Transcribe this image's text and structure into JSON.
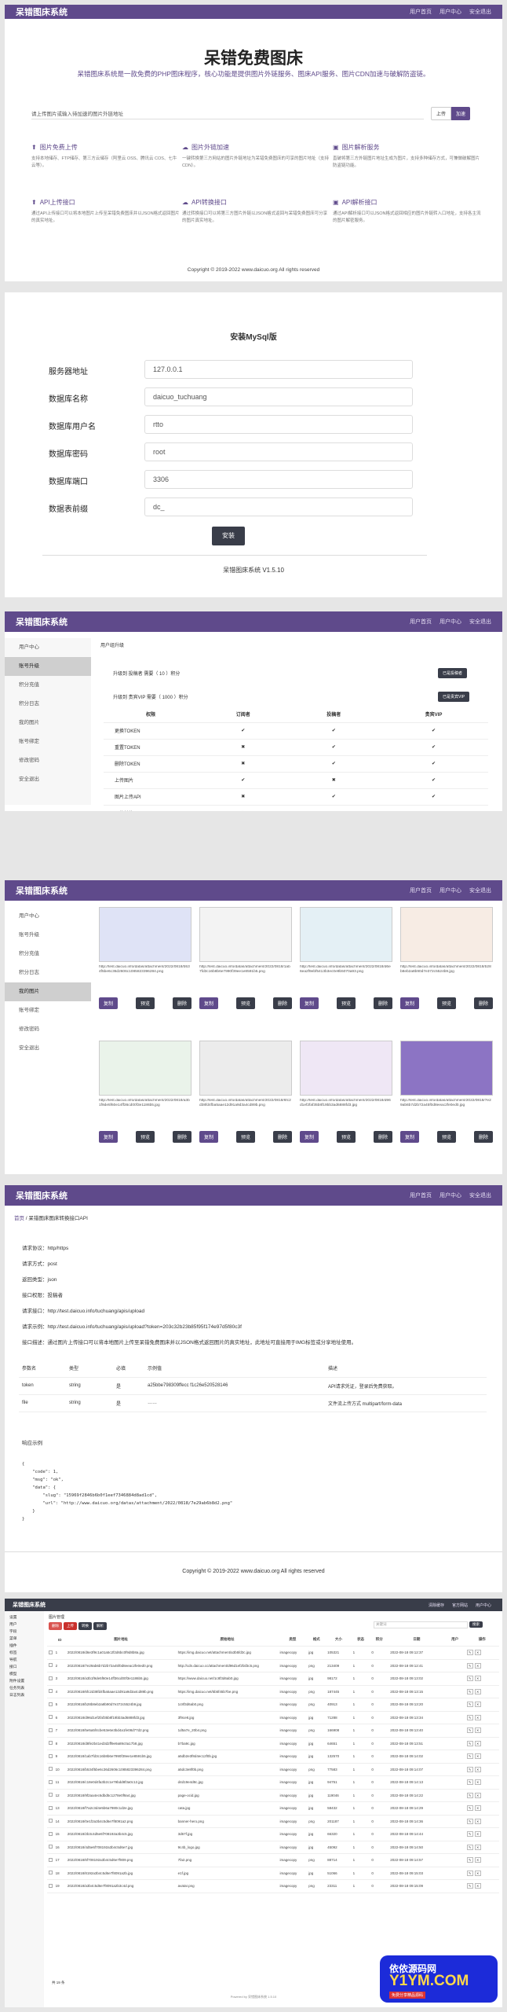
{
  "colors": {
    "purple": "#5f4a8b",
    "dark": "#393d49",
    "light": "#f7f7f7"
  },
  "s1": {
    "brand": "呆错图床系统",
    "nav": [
      "用户首页",
      "用户中心",
      "安全退出"
    ],
    "hero_title": "呆错免费图床",
    "hero_desc": "呆错图床系统是一款免费的PHP图床程序，核心功能是提供图片外链服务、图床API服务、图片CDN加速与破解防盗链。",
    "upload_tip": "请上传图片或输入待加速的图片外链地址",
    "btn_upload": "上传",
    "btn_speed": "加速",
    "features": [
      {
        "title": "图片免费上传",
        "desc": "支持本地储存、FTP储存、第三方云储存（阿里云 OSS、腾讯云 COS、七牛云等）。"
      },
      {
        "title": "图片外链加速",
        "desc": "一键转换第三方网站的图片外链地址为呆错免费图床的可享的图片地址（支持CDN）。"
      },
      {
        "title": "图片解析服务",
        "desc": "直破将第三方外链图片地址生成为图片，支持多种储存方式，可兼做破解图片防盗链功能。"
      },
      {
        "title": "API上传接口",
        "desc": "通过API上传接口可以将本地图片上传至呆错免费图床并以JSON格式返回图片的真实地址。"
      },
      {
        "title": "API转换接口",
        "desc": "通过转换接口可以将第三方图片外链以JSON格式返回与呆错免费图床可分享的图片真实地址。"
      },
      {
        "title": "API解析接口",
        "desc": "通过API解析接口可以JSON格式返回相应的图片外链转入口地址，支持各主流的图片解密服务。"
      }
    ],
    "copyright": "Copyright © 2019-2022 www.daicuo.org All rights reserved"
  },
  "s2": {
    "title": "安装MySql版",
    "fields": [
      {
        "label": "服务器地址",
        "value": "127.0.0.1"
      },
      {
        "label": "数据库名称",
        "value": "daicuo_tuchuang"
      },
      {
        "label": "数据库用户名",
        "value": "rtto"
      },
      {
        "label": "数据库密码",
        "value": "root"
      },
      {
        "label": "数据库端口",
        "value": "3306"
      },
      {
        "label": "数据表前缀",
        "value": "dc_"
      }
    ],
    "btn": "安装",
    "version": "呆错图床系统 V1.5.10"
  },
  "s3": {
    "brand": "呆错图床系统",
    "nav": [
      "用户首页",
      "用户中心",
      "安全退出"
    ],
    "menu": [
      "用户中心",
      "账号升级",
      "积分充值",
      "积分日志",
      "我的图片",
      "账号绑定",
      "修改密码",
      "安全退出"
    ],
    "crumb": "用户组升级",
    "up1": "升级到 投稿者 需要（ 10 ）积分",
    "up1_btn": "已是投稿者",
    "up2": "升级到 贵宾VIP 需要（ 1000 ）积分",
    "up2_btn": "已是贵宾VIP",
    "headers": [
      "权限",
      "订阅者",
      "投稿者",
      "贵宾VIP"
    ],
    "rows": [
      [
        "更换TOKEN",
        "✔",
        "✔",
        "✔"
      ],
      [
        "重置TOKEN",
        "✖",
        "✔",
        "✔"
      ],
      [
        "删除TOKEN",
        "✖",
        "✔",
        "✔"
      ],
      [
        "上传图片",
        "✔",
        "✖",
        "✔"
      ],
      [
        "图片上传API",
        "✖",
        "✔",
        "✔"
      ],
      [
        "图片转换API",
        "✖",
        "✔",
        "✔"
      ],
      [
        "图片解析API",
        "✖",
        "✔",
        "✔"
      ]
    ]
  },
  "s4": {
    "brand": "呆错图床系统",
    "nav": [
      "用户首页",
      "用户中心",
      "安全退出"
    ],
    "menu": [
      "用户中心",
      "账号升级",
      "积分充值",
      "积分日志",
      "我的图片",
      "账号绑定",
      "修改密码",
      "安全退出"
    ],
    "thumbs": [
      {
        "url": "http://test.daicuo.info/datas/attachment/2022/0818/b534f5be6c36d2606c1085823396284.png"
      },
      {
        "url": "http://test.daicuo.info/datas/attachment/2022/0818/1ab7fd3c16b8b6e7990f39ee1e8591b5.png"
      },
      {
        "url": "http://test.daicuo.info/datas/attachment/2022/0818/d6e6ea2f9ebf5413b3ec0e9b5070a93.png"
      },
      {
        "url": "http://test.daicuo.info/datas/attachment/2022/0818/b28b8eb2a8b90d7e372c5524b9.jpg"
      },
      {
        "url": "http://test.daicuo.info/datas/attachment/2022/0818/a3b1f9de5f60e14ff36cd00f3e1186b5.jpg"
      },
      {
        "url": "http://test.daicuo.info/datas/attachment/2022/0818/6fc2d38fd4fba5aae12d91a9d3a4cd89b.png"
      },
      {
        "url": "http://test.daicuo.info/datas/attachment/2022/0818/d96d1ef2faf35b8f19bb3ad6888fd3.jpg"
      },
      {
        "url": "http://test.daicuo.info/datas/attachment/2022/0818/7e29ab6b7d2b72a45f0d8eeac2fe0ed0.jpg"
      }
    ],
    "b_copy": "复制",
    "b_view": "预览",
    "b_del": "删除"
  },
  "s5": {
    "brand": "呆错图床系统",
    "nav": [
      "用户首页",
      "用户中心",
      "安全退出"
    ],
    "crumb": [
      "首页",
      "呆错图床图床转换接口API"
    ],
    "lines": [
      "请求协议：http/https",
      "请求方式：post",
      "返回类型：json",
      "接口权限：投稿者",
      "请求接口：http://test.daicuo.info/tuchuang/apis/upload",
      "请求示例：http://test.daicuo.info/tuchuang/apis/upload?token=203c32b23b85f95f174e97d5f80c3f",
      "接口描述：通过图片上传接口可以将本地图片上传至呆错免费图床并以JSON格式返回图片的真实地址，此地址可直接用于IMG标签或分享地址使用。"
    ],
    "headers": [
      "参数名",
      "类型",
      "必填",
      "示例值",
      "描述"
    ],
    "params": [
      [
        "token",
        "string",
        "是",
        "a25bbe798309ffecc f1c26e520528146",
        "API请求凭证，登录后免费获取。"
      ],
      [
        "file",
        "string",
        "是",
        "……",
        "文件流上传方式 multipart/form-data"
      ]
    ],
    "resp_title": "响应示例",
    "json": [
      "{",
      "    \"code\": 1,",
      "    \"msg\": \"ok\",",
      "    \"data\": {",
      "        \"slug\": \"15969f2846b6b0f1eef7346884d8ad1cd\",",
      "        \"url\": \"http://www.daicuo.org/datas/attachment/2022/0818/7e29ab6b8d2.png\"",
      "    }",
      "}"
    ],
    "copyright": "Copyright © 2019-2022 www.daicuo.org All rights reserved"
  },
  "s6": {
    "brand": "呆错图床系统",
    "top_right": [
      "清除缓存",
      "官方网站",
      "用户中心"
    ],
    "left_menu": [
      "设置",
      "用户",
      "字段",
      "菜单",
      "插件",
      "标签",
      "导航",
      "接口",
      "模型",
      "附件设置",
      "任务列表",
      "日志列表"
    ],
    "crumb": "图片管理",
    "toolbar": [
      "删除",
      "上传",
      "转换",
      "解析"
    ],
    "search_ph": "关键词",
    "search_btn": "搜索",
    "headers": [
      "",
      "ID",
      "图片地址",
      "原始地址",
      "类型",
      "格式",
      "大小",
      "状态",
      "积分",
      "日期",
      "用户",
      "操作"
    ],
    "rows": [
      [
        "1",
        "2022/0818/d6e3f9c1a01a5c2f2d6bc0f9d8b8a.jpg",
        "https://img.daicuo.net/attachment/a3b5fd3c.jpg",
        "imagecopy",
        "jpg",
        "105321",
        "1",
        "0",
        "2022-08-18 09:12:37"
      ],
      [
        "2",
        "2022/0818/7e29ab6b7d2b72a45f0d8eeac2fe0ed0.png",
        "http://cdn.daicuo.cc/attachment/d96d1ef2faf3c5.png",
        "imagecopy",
        "png",
        "213409",
        "1",
        "0",
        "2022-08-18 09:12:41"
      ],
      [
        "3",
        "2022/0818/a3b1f9de5f60e14ff36cd00f3e1186b5.jpg",
        "https://www.daicuo.net/1c8f3d6ab0.jpg",
        "imagecopy",
        "jpg",
        "98172",
        "1",
        "0",
        "2022-08-18 09:13:02"
      ],
      [
        "4",
        "2022/0818/6fc2d38fd4fba5aae12d91a9d3a4cd89b.png",
        "https://img.daicuo.net/5b5f45b7be.png",
        "imagecopy",
        "png",
        "187445",
        "1",
        "0",
        "2022-08-18 09:13:15"
      ],
      [
        "5",
        "2022/0818/b28b8eb2a8b90d7e372c5524b9.jpg",
        "1c8f3d6ab0.png",
        "imagecopy",
        "png",
        "40913",
        "1",
        "0",
        "2022-08-18 09:13:20"
      ],
      [
        "6",
        "2022/0818/d96d1ef2faf35b8f19bb3ad6888fd3.jpg",
        "3f9ce8.jpg",
        "imagecopy",
        "jpg",
        "71288",
        "1",
        "0",
        "2022-08-18 09:13:34"
      ],
      [
        "7",
        "2022/0818/5e5a5f4cbe53e6e3bd4a1fe08d77d2.png",
        "1d5a7e_20b4.png",
        "imagecopy",
        "png",
        "166908",
        "1",
        "0",
        "2022-08-18 09:13:40"
      ],
      [
        "8",
        "2022/0818/d8fe2b41ed3d2ff9e9a89c0a17b8.jpg",
        "b7ba9c.jpg",
        "imagecopy",
        "jpg",
        "64651",
        "1",
        "0",
        "2022-08-18 09:13:51"
      ],
      [
        "9",
        "2022/0818/1ab7fd3c16b8b6e7990f39ee1e8591b5.jpg",
        "a5db2e3f8d4ec12f0b.jpg",
        "imagecopy",
        "jpg",
        "132570",
        "1",
        "0",
        "2022-08-18 09:14:02"
      ],
      [
        "10",
        "2022/0818/b534f5be6c36d2606c1085823396284.png",
        "a5dc3e8f0b.png",
        "imagecopy",
        "png",
        "77583",
        "1",
        "0",
        "2022-08-18 09:14:07"
      ],
      [
        "11",
        "2022/0818/c18e0d4fa3b2c1e79bdd8f3a0c12.jpg",
        "d4d19e4d8c.jpg",
        "imagecopy",
        "jpg",
        "94751",
        "1",
        "0",
        "2022-08-18 09:14:13"
      ],
      [
        "12",
        "2022/0818/9f2aa4ec6dbd5c1278e0f9a4.jpg",
        "page-ocid.jpg",
        "imagecopy",
        "jpg",
        "119046",
        "1",
        "0",
        "2022-08-18 09:14:22"
      ],
      [
        "13",
        "2022/0818/f7a2c3d4e5b6a7980c1d2e.jpg",
        "cata.jpg",
        "imagecopy",
        "jpg",
        "58432",
        "1",
        "0",
        "2022-08-18 09:14:29"
      ],
      [
        "14",
        "2022/0818/0e1f2a3b4c5d6e7f8091a2.png",
        "banner-hero.png",
        "imagecopy",
        "png",
        "201187",
        "1",
        "0",
        "2022-08-18 09:14:36"
      ],
      [
        "15",
        "2022/0818/2b3c4d5e6f708192a3b4c5.jpg",
        "3d67f.jpg",
        "imagecopy",
        "jpg",
        "66320",
        "1",
        "0",
        "2022-08-18 09:14:44"
      ],
      [
        "16",
        "2022/0818/4d5e6f708192a3b4c5d6e7.jpg",
        "9c4b_logo.jpg",
        "imagecopy",
        "jpg",
        "45092",
        "1",
        "0",
        "2022-08-18 09:14:50"
      ],
      [
        "17",
        "2022/0818/6f708192a3b4c5d6e7f809.png",
        "7fa2.png",
        "imagecopy",
        "png",
        "88714",
        "1",
        "0",
        "2022-08-18 09:14:57"
      ],
      [
        "18",
        "2022/0818/8192a3b4c5d6e7f8091a2b.jpg",
        "e1f.jpg",
        "imagecopy",
        "jpg",
        "51066",
        "1",
        "0",
        "2022-08-18 09:15:03"
      ],
      [
        "19",
        "2022/0818/a3b4c5d6e7f8091a2b3c4d.png",
        "avatar.png",
        "imagecopy",
        "png",
        "23311",
        "1",
        "0",
        "2022-08-18 09:15:09"
      ]
    ],
    "pager": "共 19 条",
    "version": "Powered by 呆错图床系统 1.5.10",
    "watermark_main": "依依源码网",
    "watermark_url": "Y1YM.COM",
    "watermark_sub": "免费分享精品源码"
  }
}
